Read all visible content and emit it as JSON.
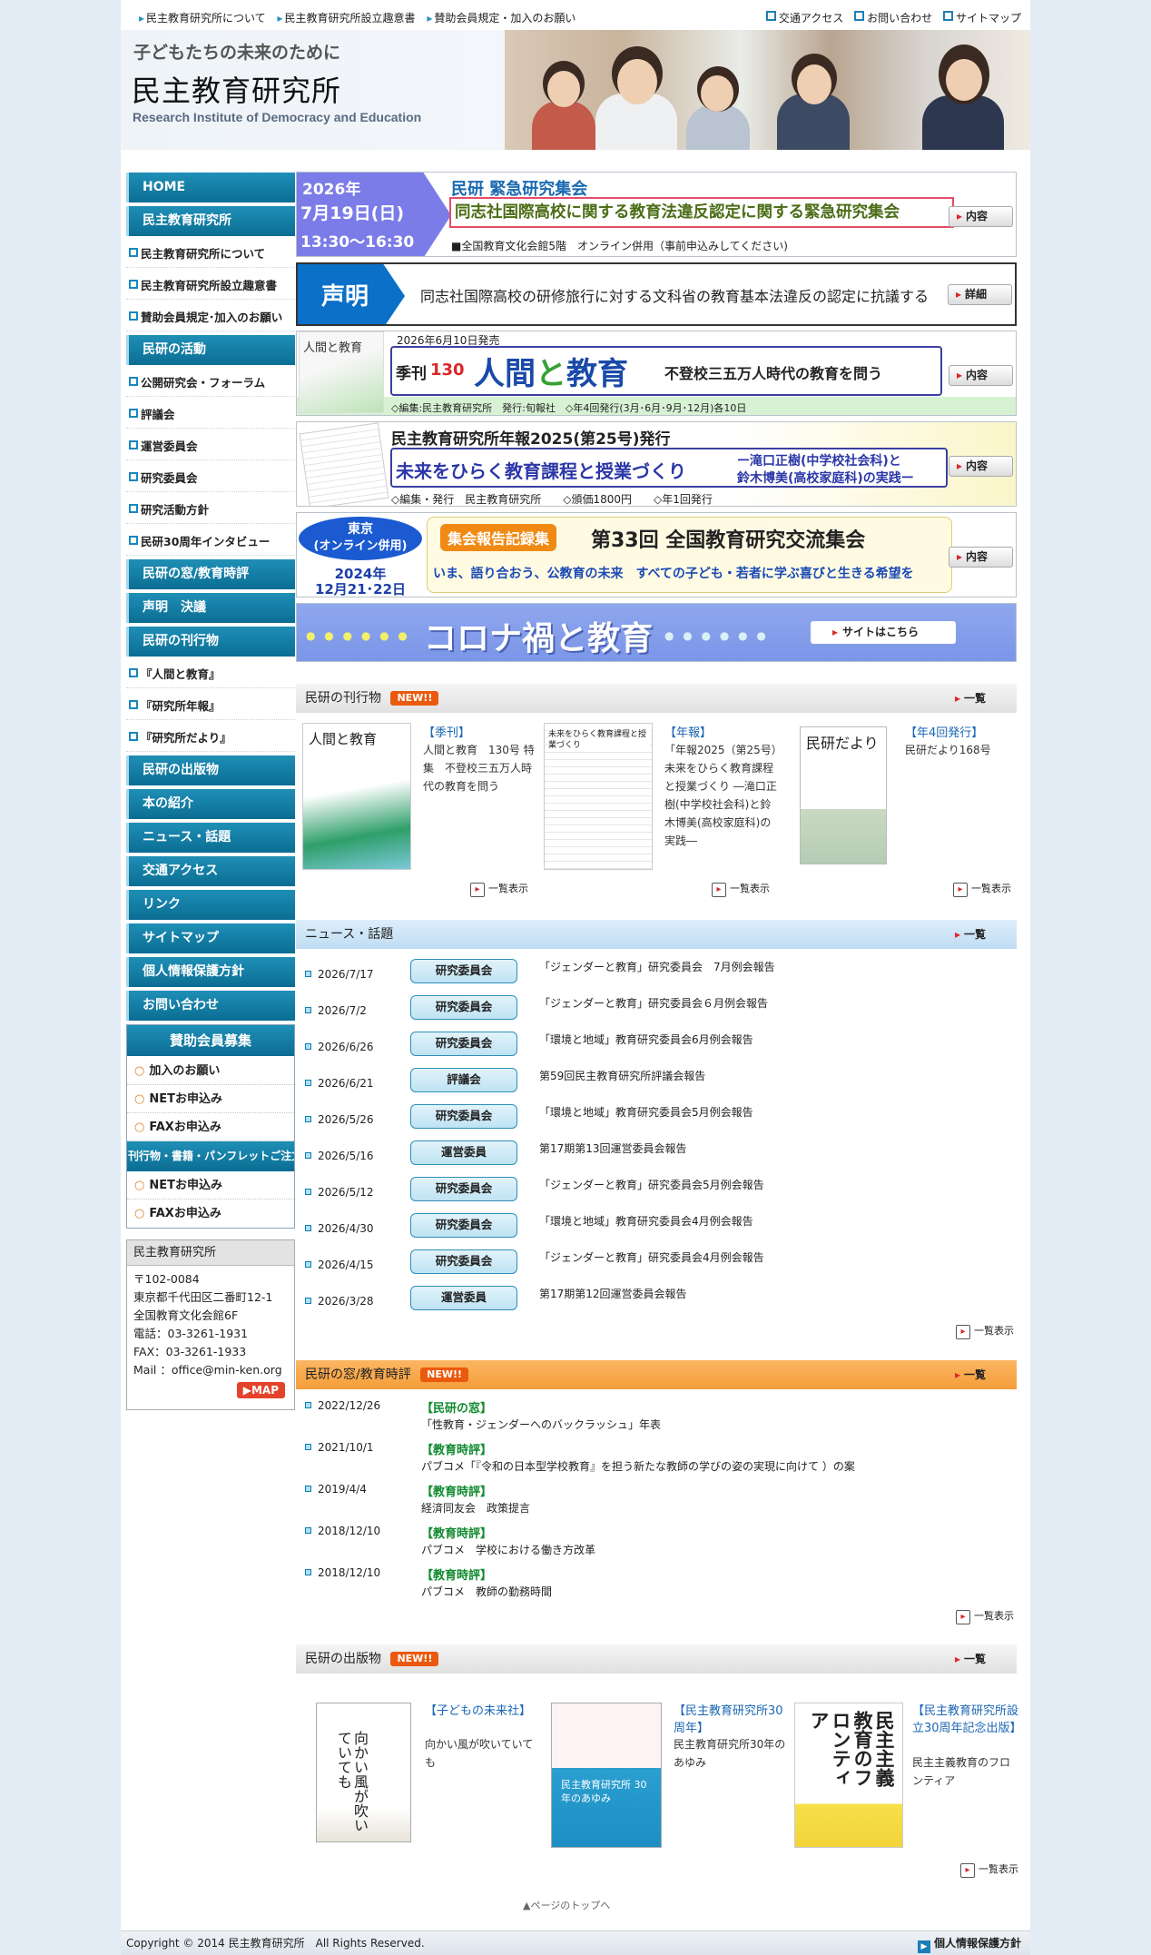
{
  "topnav": {
    "left": [
      "民主教育研究所について",
      "民主教育研究所設立趣意書",
      "賛助会員規定・加入のお願い"
    ],
    "right": [
      "交通アクセス",
      "お問い合わせ",
      "サイトマップ"
    ]
  },
  "header": {
    "catch": "子どもたちの未来のために",
    "name": "民主教育研究所",
    "english": "Research Institute of Democracy and Education"
  },
  "sidebar": {
    "nav": [
      {
        "label": "HOME",
        "kind": "main"
      },
      {
        "label": "民主教育研究所",
        "kind": "main"
      },
      {
        "label": "民主教育研究所について",
        "kind": "sub"
      },
      {
        "label": "民主教育研究所設立趣意書",
        "kind": "sub"
      },
      {
        "label": "賛助会員規定･加入のお願い",
        "kind": "sub"
      },
      {
        "label": "民研の活動",
        "kind": "main"
      },
      {
        "label": "公開研究会・フォーラム",
        "kind": "sub"
      },
      {
        "label": "評議会",
        "kind": "sub"
      },
      {
        "label": "運営委員会",
        "kind": "sub"
      },
      {
        "label": "研究委員会",
        "kind": "sub"
      },
      {
        "label": "研究活動方針",
        "kind": "sub"
      },
      {
        "label": "民研30周年インタビュー",
        "kind": "sub"
      },
      {
        "label": "民研の窓/教育時評",
        "kind": "main"
      },
      {
        "label": "声明　決議",
        "kind": "main"
      },
      {
        "label": "民研の刊行物",
        "kind": "main"
      },
      {
        "label": "『人間と教育』",
        "kind": "sub"
      },
      {
        "label": "『研究所年報』",
        "kind": "sub"
      },
      {
        "label": "『研究所だより』",
        "kind": "sub"
      },
      {
        "label": "民研の出版物",
        "kind": "main"
      },
      {
        "label": "本の紹介",
        "kind": "main"
      },
      {
        "label": "ニュース・話題",
        "kind": "main"
      },
      {
        "label": "交通アクセス",
        "kind": "main"
      },
      {
        "label": "リンク",
        "kind": "main"
      },
      {
        "label": "サイトマップ",
        "kind": "main"
      },
      {
        "label": "個人情報保護方針",
        "kind": "main"
      },
      {
        "label": "お問い合わせ",
        "kind": "main"
      }
    ],
    "support_head": "賛助会員募集",
    "support_items": [
      "加入のお願い",
      "NETお申込み",
      "FAXお申込み"
    ],
    "order_head": "刊行物・書籍・パンフレットご注文",
    "order_items": [
      "NETお申込み",
      "FAXお申込み"
    ],
    "address": {
      "title": "民主教育研究所",
      "lines": [
        "〒102-0084",
        "東京都千代田区二番町12-1",
        "全国教育文化会館6F",
        "電話：03-3261-1931",
        "FAX：03-3261-1933",
        "Mail ：office@min-ken.org"
      ],
      "map": "MAP"
    }
  },
  "banners": {
    "b1": {
      "year": "2026年",
      "date": "7月19日(日)",
      "time": "13:30～16:30",
      "head": "民研 緊急研究集会",
      "title": "同志社国際高校に関する教育法違反認定に関する緊急研究集会",
      "venue": "■全国教育文化会館5階　オンライン併用（事前申込みしてください)",
      "btn": "内容"
    },
    "b2": {
      "label": "声明",
      "text": "同志社国際高校の研修旅行に対する文科省の教育基本法違反の認定に抗議する",
      "btn": "詳細"
    },
    "b3": {
      "release": "2026年6月10日発売",
      "kikan": "季刊",
      "num": "130",
      "t1": "人間",
      "t2": "と",
      "t3": "教育",
      "sub": "不登校三五万人時代の教育を問う",
      "foot": "◇編集:民主教育研究所　発行:旬報社　◇年4回発行(3月･6月･9月･12月)各10日",
      "btn": "内容",
      "cover": "人間と教育"
    },
    "b4": {
      "head": "民主教育研究所年報2025(第25号)発行",
      "main": "未来をひらく教育課程と授業づくり",
      "auth1": "ー滝口正樹(中学校社会科)と",
      "auth2": "鈴木博美(高校家庭科)の実践ー",
      "foot": "◇編集・発行　民主教育研究所　　◇頒価1800円　　◇年1回発行",
      "btn": "内容"
    },
    "b5": {
      "place1": "東京",
      "place2": "(オンライン併用)",
      "year": "2024年",
      "date": "12月21･22日",
      "badge": "集会報告記録集",
      "title": "第33回 全国教育研究交流集会",
      "sub": "いま、語り合おう、公教育の未来　すべての子ども・若者に学ぶ喜びと生きる希望を",
      "btn": "内容"
    },
    "b6": {
      "title": "コロナ禍と教育",
      "btn": "サイトはこちら"
    }
  },
  "publications": {
    "title": "民研の刊行物",
    "new": "NEW!!",
    "more": "一覧",
    "list_all": "一覧表示",
    "items": [
      {
        "cat": "【季刊】",
        "text": "人間と教育　130号 特集　不登校三五万人時代の教育を問う",
        "cover": "人間と教育"
      },
      {
        "cat": "【年報】",
        "text": "「年報2025（第25号）未来をひらく教育課程と授業づくり ―滝口正樹(中学校社会科)と鈴木博美(高校家庭科)の実践―",
        "cover": "未来をひらく教育課程と授業づくり"
      },
      {
        "cat": "【年4回発行】",
        "text": "民研だより168号",
        "cover": "民研だより"
      }
    ]
  },
  "news": {
    "title": "ニュース・話題",
    "more": "一覧",
    "list_all": "一覧表示",
    "items": [
      {
        "date": "2026/7/17",
        "tag": "研究委員会",
        "title": "「ジェンダーと教育」研究委員会　7月例会報告"
      },
      {
        "date": "2026/7/2",
        "tag": "研究委員会",
        "title": "「ジェンダーと教育」研究委員会６月例会報告"
      },
      {
        "date": "2026/6/26",
        "tag": "研究委員会",
        "title": "「環境と地域」教育研究委員会6月例会報告"
      },
      {
        "date": "2026/6/21",
        "tag": "評議会",
        "title": "第59回民主教育研究所評議会報告"
      },
      {
        "date": "2026/5/26",
        "tag": "研究委員会",
        "title": "「環境と地域」教育研究委員会5月例会報告"
      },
      {
        "date": "2026/5/16",
        "tag": "運営委員",
        "title": "第17期第13回運営委員会報告"
      },
      {
        "date": "2026/5/12",
        "tag": "研究委員会",
        "title": "「ジェンダーと教育」研究委員会5月例会報告"
      },
      {
        "date": "2026/4/30",
        "tag": "研究委員会",
        "title": "「環境と地域」教育研究委員会4月例会報告"
      },
      {
        "date": "2026/4/15",
        "tag": "研究委員会",
        "title": "「ジェンダーと教育」研究委員会4月例会報告"
      },
      {
        "date": "2026/3/28",
        "tag": "運営委員",
        "title": "第17期第12回運営委員会報告"
      }
    ]
  },
  "window": {
    "title": "民研の窓/教育時評",
    "new": "NEW!!",
    "more": "一覧",
    "list_all": "一覧表示",
    "items": [
      {
        "date": "2022/12/26",
        "cat": "【民研の窓】",
        "title": "「性教育・ジェンダーへのバックラッシュ」年表"
      },
      {
        "date": "2021/10/1",
        "cat": "【教育時評】",
        "title": "パブコメ「『令和の日本型学校教育』を担う新たな教師の学びの姿の実現に向けて ）の案"
      },
      {
        "date": "2019/4/4",
        "cat": "【教育時評】",
        "title": "経済同友会　政策提言"
      },
      {
        "date": "2018/12/10",
        "cat": "【教育時評】",
        "title": "パブコメ　学校における働き方改革"
      },
      {
        "date": "2018/12/10",
        "cat": "【教育時評】",
        "title": "パブコメ　教師の勤務時間"
      }
    ]
  },
  "books": {
    "title": "民研の出版物",
    "new": "NEW!!",
    "more": "一覧",
    "list_all": "一覧表示",
    "items": [
      {
        "cat": "【子どもの未来社】",
        "text": "向かい風が吹いていても",
        "cover": "向かい風が吹いていても"
      },
      {
        "cat": "【民主教育研究所30周年】",
        "text": "民主教育研究所30年のあゆみ",
        "cover": "民主教育研究所 30年のあゆみ"
      },
      {
        "cat": "【民主教育研究所設立30周年記念出版】",
        "text": "民主主義教育のフロンティア",
        "cover": "民主主義 教育のフロンティア"
      }
    ]
  },
  "pagetop": "▲ページのトップへ",
  "footer": {
    "copyright": "Copyright © 2014 民主教育研究所　All Rights Reserved.",
    "privacy": "個人情報保護方針"
  }
}
